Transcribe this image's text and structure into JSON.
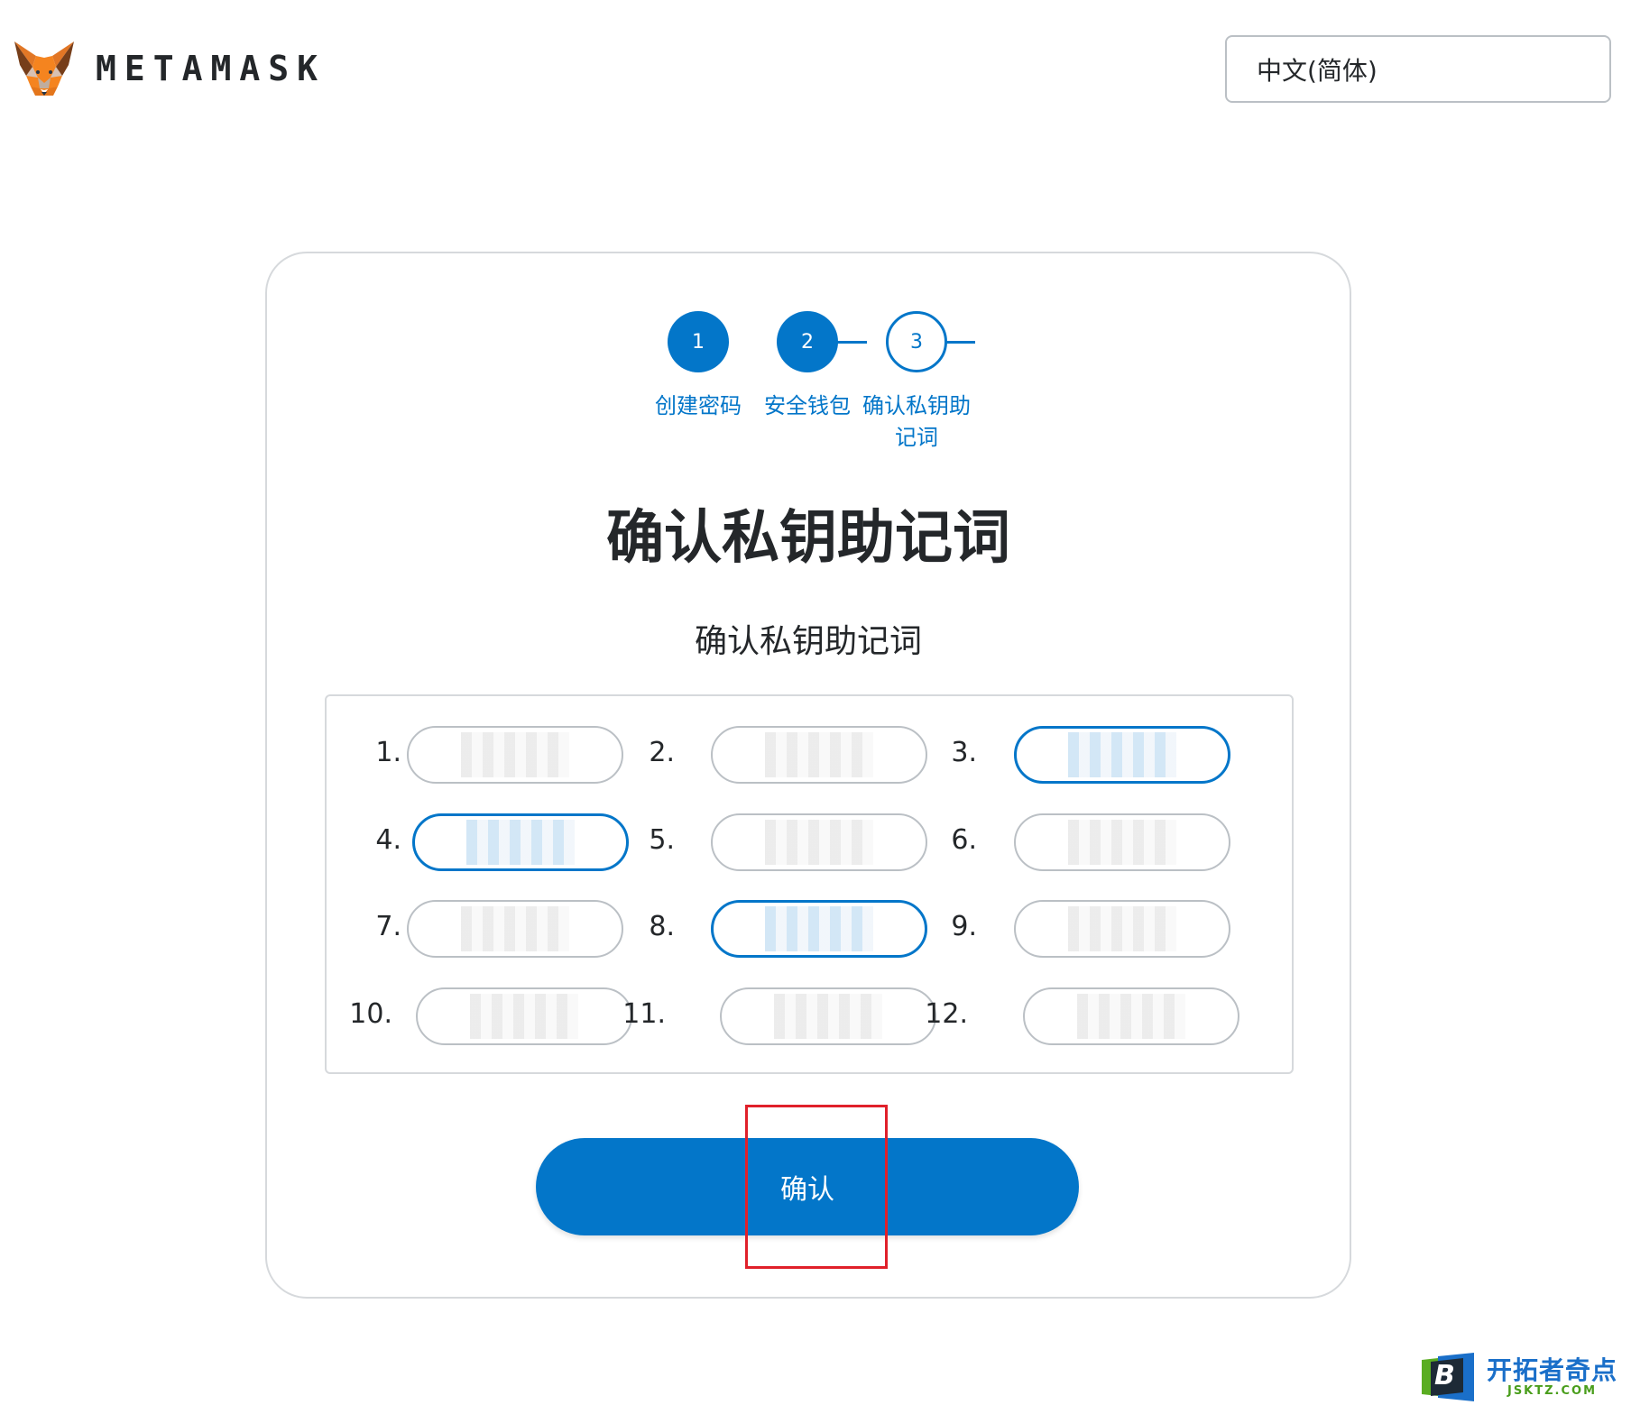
{
  "header": {
    "wordmark": "METAMASK",
    "logo_icon": "metamask-fox-icon",
    "language_selected": "中文(简体)"
  },
  "stepper": {
    "steps": [
      {
        "number": "1",
        "label": "创建密码",
        "state": "done"
      },
      {
        "number": "2",
        "label": "安全钱包",
        "state": "done"
      },
      {
        "number": "3",
        "label": "确认私钥助\n记词",
        "state": "current"
      }
    ]
  },
  "main": {
    "title": "确认私钥助记词",
    "subtitle": "确认私钥助记词",
    "words": [
      {
        "number": "1.",
        "value": "",
        "active": false
      },
      {
        "number": "2.",
        "value": "",
        "active": false
      },
      {
        "number": "3.",
        "value": "",
        "active": true
      },
      {
        "number": "4.",
        "value": "",
        "active": true
      },
      {
        "number": "5.",
        "value": "",
        "active": false
      },
      {
        "number": "6.",
        "value": "",
        "active": false
      },
      {
        "number": "7.",
        "value": "",
        "active": false
      },
      {
        "number": "8.",
        "value": "",
        "active": true
      },
      {
        "number": "9.",
        "value": "",
        "active": false
      },
      {
        "number": "10.",
        "value": "",
        "active": false
      },
      {
        "number": "11.",
        "value": "",
        "active": false
      },
      {
        "number": "12.",
        "value": "",
        "active": false
      }
    ],
    "confirm_label": "确认"
  },
  "watermark": {
    "badge_letter": "B",
    "title": "开拓者奇点",
    "subtitle": "JSKTZ.COM"
  },
  "colors": {
    "accent": "#0376c9",
    "highlight": "#e0202a",
    "border": "#d6d9dc"
  }
}
